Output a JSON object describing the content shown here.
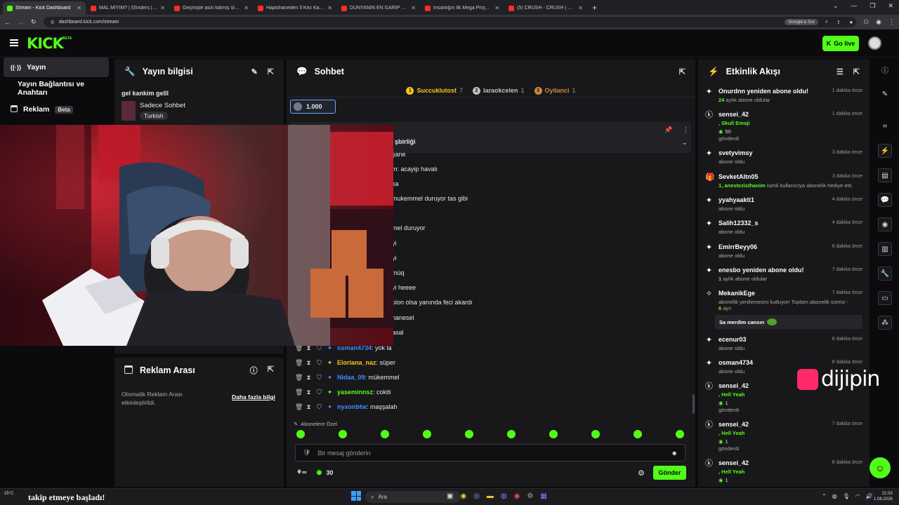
{
  "browser": {
    "tabs": [
      {
        "title": "Stream - Kick Dashboard",
        "fav": "#53fc18",
        "active": true
      },
      {
        "title": "MAL MIYIM? | 5Sriders | Moto",
        "fav": "#ff2b2b"
      },
      {
        "title": "Geçmişte asılı kalmış ülke: Küb",
        "fav": "#ff2b2b"
      },
      {
        "title": "Hapishaneden 3 Kez Kaçan Ad",
        "fav": "#ff2b2b"
      },
      {
        "title": "DÜNYANIN EN GARİP ADASIN",
        "fav": "#ff2b2b"
      },
      {
        "title": "İnsanlığın İlk Mega Projesi Gö",
        "fav": "#ff2b2b"
      },
      {
        "title": "(5) CRUSH - CRUSH | Official M",
        "fav": "#ff2b2b"
      }
    ],
    "url": "dashboard.kick.com/stream",
    "google_chip": "Google'a Sor"
  },
  "header": {
    "logo": "KICK",
    "logo_badge": "BETA",
    "go_live": "Go live"
  },
  "sidebar": {
    "items": [
      {
        "label": "Yayın",
        "icon": "broadcast-icon"
      },
      {
        "label": "Yayın Bağlantısı ve Anahtarı"
      },
      {
        "label": "Reklam",
        "badge": "Beta"
      }
    ]
  },
  "stream_info": {
    "title": "Yayın bilgisi",
    "stream_title": "gel kankim gelll",
    "category": "Sadece Sohbet",
    "tag": "Turkish"
  },
  "ad_break": {
    "title": "Reklam Arası",
    "text": "Otomatik Reklam Arası etkinleştirildi.",
    "link": "Daha fazla bilgi"
  },
  "chat": {
    "title": "Sohbet",
    "top_gifters": [
      {
        "rank": "1",
        "name": "Succuklutost",
        "count": "7",
        "color": "#f5c518"
      },
      {
        "rank": "2",
        "name": "laraokcelen",
        "count": "1",
        "color": "#c0c0c0"
      },
      {
        "rank": "3",
        "name": "Oyilanci",
        "count": "1",
        "color": "#d08a3c"
      }
    ],
    "pinned_amount": "1.000",
    "pinned_header_partial": "şbirliği",
    "partial_lines": [
      "şane",
      "m: acayip havalı",
      "ka",
      "mukemmel duruyor tas gibi",
      "mel duruyor",
      "yi",
      "yi",
      "müq",
      "yi heeee",
      "pion olsa yanında feci akardı",
      "hanesel",
      "asal"
    ],
    "messages": [
      {
        "user": "osman4734",
        "color": "#3f8cff",
        "text": ": yok la"
      },
      {
        "user": "Eloriana_naz",
        "color": "#f5c518",
        "text": ": süper"
      },
      {
        "user": "Nidaa_09",
        "color": "#3f8cff",
        "text": ": mükemmel"
      },
      {
        "user": "yaseminnsz",
        "color": "#53fc18",
        "text": ": cokiti"
      },
      {
        "user": "nyxonbtw",
        "color": "#3f8cff",
        "text": ": maşşalah"
      }
    ],
    "emote_section": "Abonelere Özel",
    "input_placeholder": "Bir mesaj gönderin",
    "viewer_count": "30",
    "send_label": "Gönder"
  },
  "activity": {
    "title": "Etkinlik Akışı",
    "items": [
      {
        "icon": "star-icon",
        "name": "Onurdnn yeniden abone oldu!",
        "time": "1 dakika önce",
        "l1_green": "24",
        "l1_rest": " aylık abone oldular"
      },
      {
        "icon": "kick-coin-icon",
        "name": "sensei_42",
        "time": "1 dakika önce",
        "l1_green": ", Skull Emoji",
        "l2": "50",
        "l3": "gönderdi"
      },
      {
        "icon": "star-icon",
        "name": "svetyvimsy",
        "time": "3 dakika önce",
        "l1_rest": "abone oldu"
      },
      {
        "icon": "gift-icon",
        "name": "SevketAltn05",
        "time": "3 dakika önce",
        "l1_green": "1, anestezisthanim",
        "l1_rest": " isimli kullanıcıya abonelik hediye etti."
      },
      {
        "icon": "star-icon",
        "name": "yyahyaakti1",
        "time": "4 dakika önce",
        "l1_rest": "abone oldu"
      },
      {
        "icon": "star-icon",
        "name": "Salih12332_s",
        "time": "4 dakika önce",
        "l1_rest": "abone oldu"
      },
      {
        "icon": "star-icon",
        "name": "EmirrBeyy06",
        "time": "6 dakika önce",
        "l1_rest": "abone oldu"
      },
      {
        "icon": "star-icon",
        "name": "enesbo yeniden abone oldu!",
        "time": "7 dakika önce",
        "l1_green": "1",
        "l1_rest": " aylık abone oldular"
      },
      {
        "icon": "celebrate-icon",
        "name": "MekanikEge",
        "time": "7 dakika önce",
        "l1_rest": "abonelik yenilemesini kutluyor! Toplam abonelik süresi -",
        "l2_green": "6",
        "l2_rest": " ayı!",
        "bubble": "Sa merdim cansın"
      },
      {
        "icon": "star-icon",
        "name": "ecenur03",
        "time": "8 dakika önce",
        "l1_rest": "abone oldu"
      },
      {
        "icon": "star-icon",
        "name": "osman4734",
        "time": "8 dakika önce",
        "l1_rest": "abone oldu"
      },
      {
        "icon": "kick-coin-icon",
        "name": "sensei_42",
        "time": "",
        "l1_green": ", Hell Yeah",
        "l2": "1",
        "l3": "gönderdi"
      },
      {
        "icon": "kick-coin-icon",
        "name": "sensei_42",
        "time": "7 dakika önce",
        "l1_green": ", Hell Yeah",
        "l2": "1",
        "l3": "gönderdi"
      },
      {
        "icon": "kick-coin-icon",
        "name": "sensei_42",
        "time": "8 dakika önce",
        "l1_green": ", Hell Yeah",
        "l2": "1",
        "l3": ""
      }
    ]
  },
  "watermark": "dijipin",
  "taskbar": {
    "weather_temp": "25°C",
    "notification": "takip etmeye başladı!",
    "search": "Ara",
    "time": "21:03",
    "date": "1.08.2026"
  },
  "colors": {
    "accent": "#53fc18",
    "panel": "#18181b",
    "bg": "#0b0b0d"
  }
}
